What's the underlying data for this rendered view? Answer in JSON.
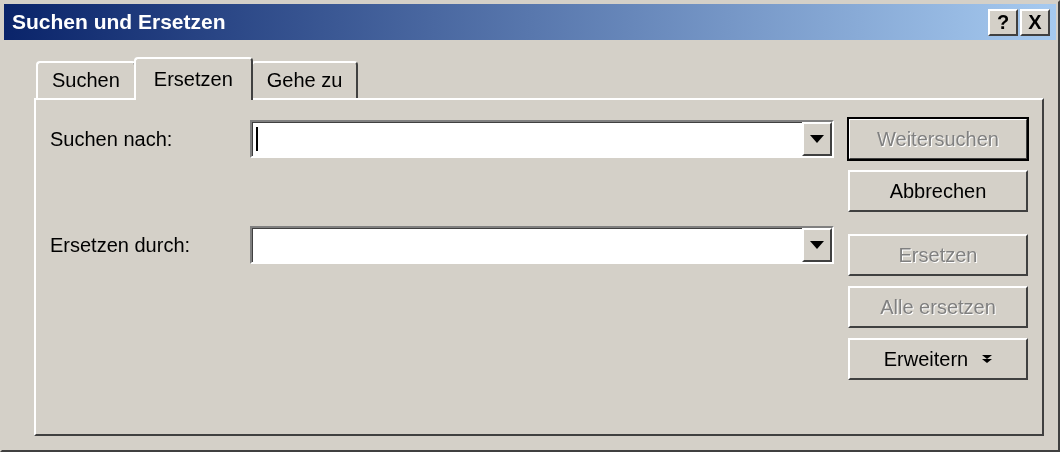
{
  "window": {
    "title": "Suchen und Ersetzen",
    "title_buttons": [
      {
        "label": "?"
      },
      {
        "label": "X"
      }
    ]
  },
  "tabs": [
    {
      "label": "Suchen",
      "selected": false
    },
    {
      "label": "Ersetzen",
      "selected": true
    },
    {
      "label": "Gehe zu",
      "selected": false
    }
  ],
  "fields": [
    {
      "label": "Suchen nach:",
      "focused": true
    },
    {
      "label": "Ersetzen durch:",
      "focused": false
    }
  ],
  "buttons": [
    {
      "label": "Weitersuchen",
      "disabled": true,
      "default": true,
      "kind": "plain"
    },
    {
      "label": "Abbrechen",
      "disabled": false,
      "default": false,
      "kind": "plain"
    },
    {
      "label": "Ersetzen",
      "disabled": true,
      "default": false,
      "kind": "plain"
    },
    {
      "label": "Alle ersetzen",
      "disabled": true,
      "default": false,
      "kind": "plain"
    },
    {
      "label": "Erweitern",
      "disabled": false,
      "default": false,
      "kind": "expand"
    }
  ]
}
